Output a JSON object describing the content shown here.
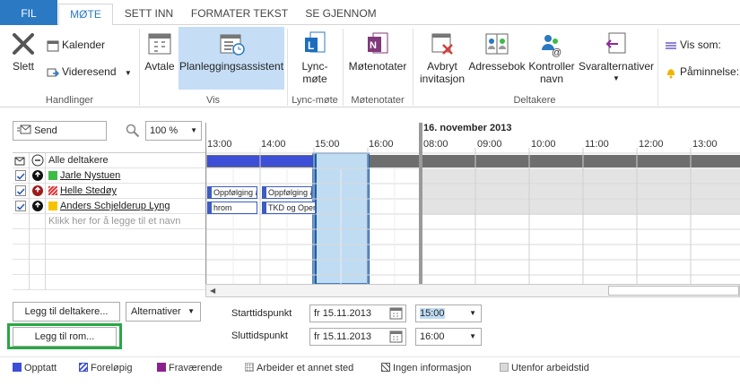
{
  "tabs": [
    "FIL",
    "MØTE",
    "SETT INN",
    "FORMATER TEKST",
    "SE GJENNOM"
  ],
  "ribbon": {
    "delete": "Slett",
    "calendar": "Kalender",
    "forward": "Videresend",
    "group_actions": "Handlinger",
    "appointment": "Avtale",
    "scheduling": "Planleggingsassistent",
    "group_view": "Vis",
    "lync_line1": "Lync-",
    "lync_line2": "møte",
    "group_lync": "Lync-møte",
    "meeting_notes": "Møtenotater",
    "group_notes": "Møtenotater",
    "cancel_line1": "Avbryt",
    "cancel_line2": "invitasjon",
    "address_book": "Adressebok",
    "check_line1": "Kontroller",
    "check_line2": "navn",
    "response_options": "Svaralternativer",
    "group_attendees": "Deltakere",
    "show_as": "Vis som:",
    "reminder": "Påminnelse:"
  },
  "toolbar": {
    "send": "Send",
    "zoom": "100 %"
  },
  "date_header": "16. november 2013",
  "hours": [
    "13:00",
    "14:00",
    "15:00",
    "16:00",
    "08:00",
    "09:00",
    "10:00",
    "11:00",
    "12:00",
    "13:00"
  ],
  "attendees": {
    "header": "Alle deltakere",
    "rows": [
      {
        "name": "Jarle Nystuen",
        "color": "#3dbb46"
      },
      {
        "name": "Helle Stedøy",
        "color": "#e03a3a"
      },
      {
        "name": "Anders Schjelderup Lyng",
        "color": "#f5c400"
      }
    ],
    "placeholder": "Klikk her for å legge til et navn"
  },
  "appointments": [
    "Oppfølging a",
    "Oppfølging a",
    "hrom",
    "TKD og Oper"
  ],
  "buttons": {
    "add_attendees": "Legg til deltakere...",
    "options": "Alternativer",
    "add_room": "Legg til rom..."
  },
  "times": {
    "start_label": "Starttidspunkt",
    "start_date": "fr 15.11.2013",
    "start_time": "15:00",
    "end_label": "Sluttidspunkt",
    "end_date": "fr 15.11.2013",
    "end_time": "16:00"
  },
  "legend": [
    "Opptatt",
    "Foreløpig",
    "Fraværende",
    "Arbeider et annet sted",
    "Ingen informasjon",
    "Utenfor arbeidstid"
  ],
  "colors": {
    "accent": "#2b79c2",
    "busy": "#3c4fd6",
    "selection": "#bfdcf3",
    "highlight_box": "#28a745",
    "oof": "#8b1f8f"
  }
}
